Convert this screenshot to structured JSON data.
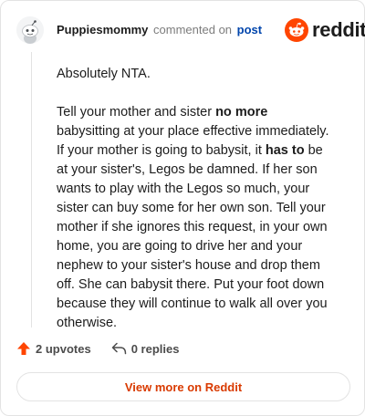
{
  "header": {
    "username": "Puppiesmommy",
    "commented_text": "commented on",
    "post_link": "post",
    "logo_text": "reddit",
    "logo_icon": "reddit-alien-icon"
  },
  "comment": {
    "line1": "Absolutely NTA.",
    "p2_a": "Tell your mother and sister ",
    "p2_bold1": "no more",
    "p2_b": " babysitting at your place effective immediately. If your mother is going to babysit, it ",
    "p2_bold2": "has to",
    "p2_c": " be at your sister's, Legos be damned. If her son wants to play with the Legos so much, your sister can buy some for her own son. Tell your mother if she ignores this request, in your own home, you are going to drive her and your nephew to your sister's house and drop them off. She can babysit there. Put your foot down because they will continue to walk all over you otherwise."
  },
  "actions": {
    "upvotes": "2 upvotes",
    "replies": "0 replies"
  },
  "footer": {
    "view_more": "View more on Reddit"
  },
  "colors": {
    "brand": "#ff4500",
    "link": "#0045ac",
    "view_more": "#d93a00"
  }
}
